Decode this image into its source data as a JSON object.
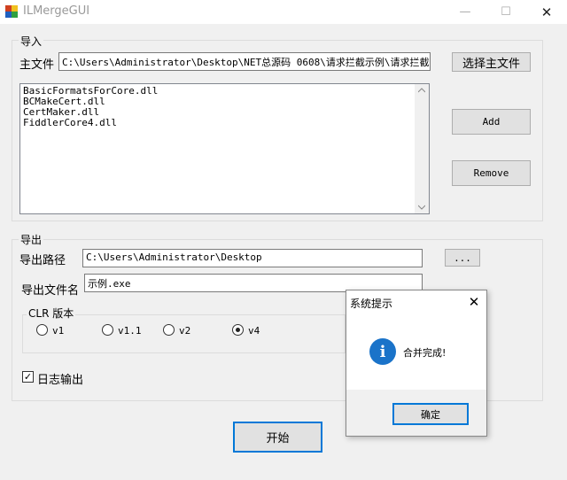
{
  "window": {
    "title": "ILMergeGUI",
    "minimize_glyph": "—",
    "maximize_glyph": "☐",
    "close_glyph": "✕"
  },
  "import": {
    "group_label": "导入",
    "main_file_label": "主文件",
    "main_file_value": "C:\\Users\\Administrator\\Desktop\\NET总源码 0608\\请求拦截示例\\请求拦截示",
    "choose_main_button": "选择主文件",
    "files": [
      "BasicFormatsForCore.dll",
      "BCMakeCert.dll",
      "CertMaker.dll",
      "FiddlerCore4.dll"
    ],
    "add_button": "Add",
    "remove_button": "Remove"
  },
  "export": {
    "group_label": "导出",
    "path_label": "导出路径",
    "path_value": "C:\\Users\\Administrator\\Desktop",
    "browse_button": "...",
    "filename_label": "导出文件名",
    "filename_value": "示例.exe",
    "clr_group_label": "CLR  版本",
    "clr_options": [
      {
        "label": "v1",
        "checked": false
      },
      {
        "label": "v1.1",
        "checked": false
      },
      {
        "label": "v2",
        "checked": false
      },
      {
        "label": "v4",
        "checked": true
      }
    ],
    "log_checkbox_label": "日志输出",
    "log_checked": true
  },
  "start_button": "开始",
  "dialog": {
    "title": "系统提示",
    "close_glyph": "✕",
    "message": "合并完成!",
    "icon_glyph": "i",
    "ok_button": "确定",
    "icon_color": "#1a73c9"
  }
}
